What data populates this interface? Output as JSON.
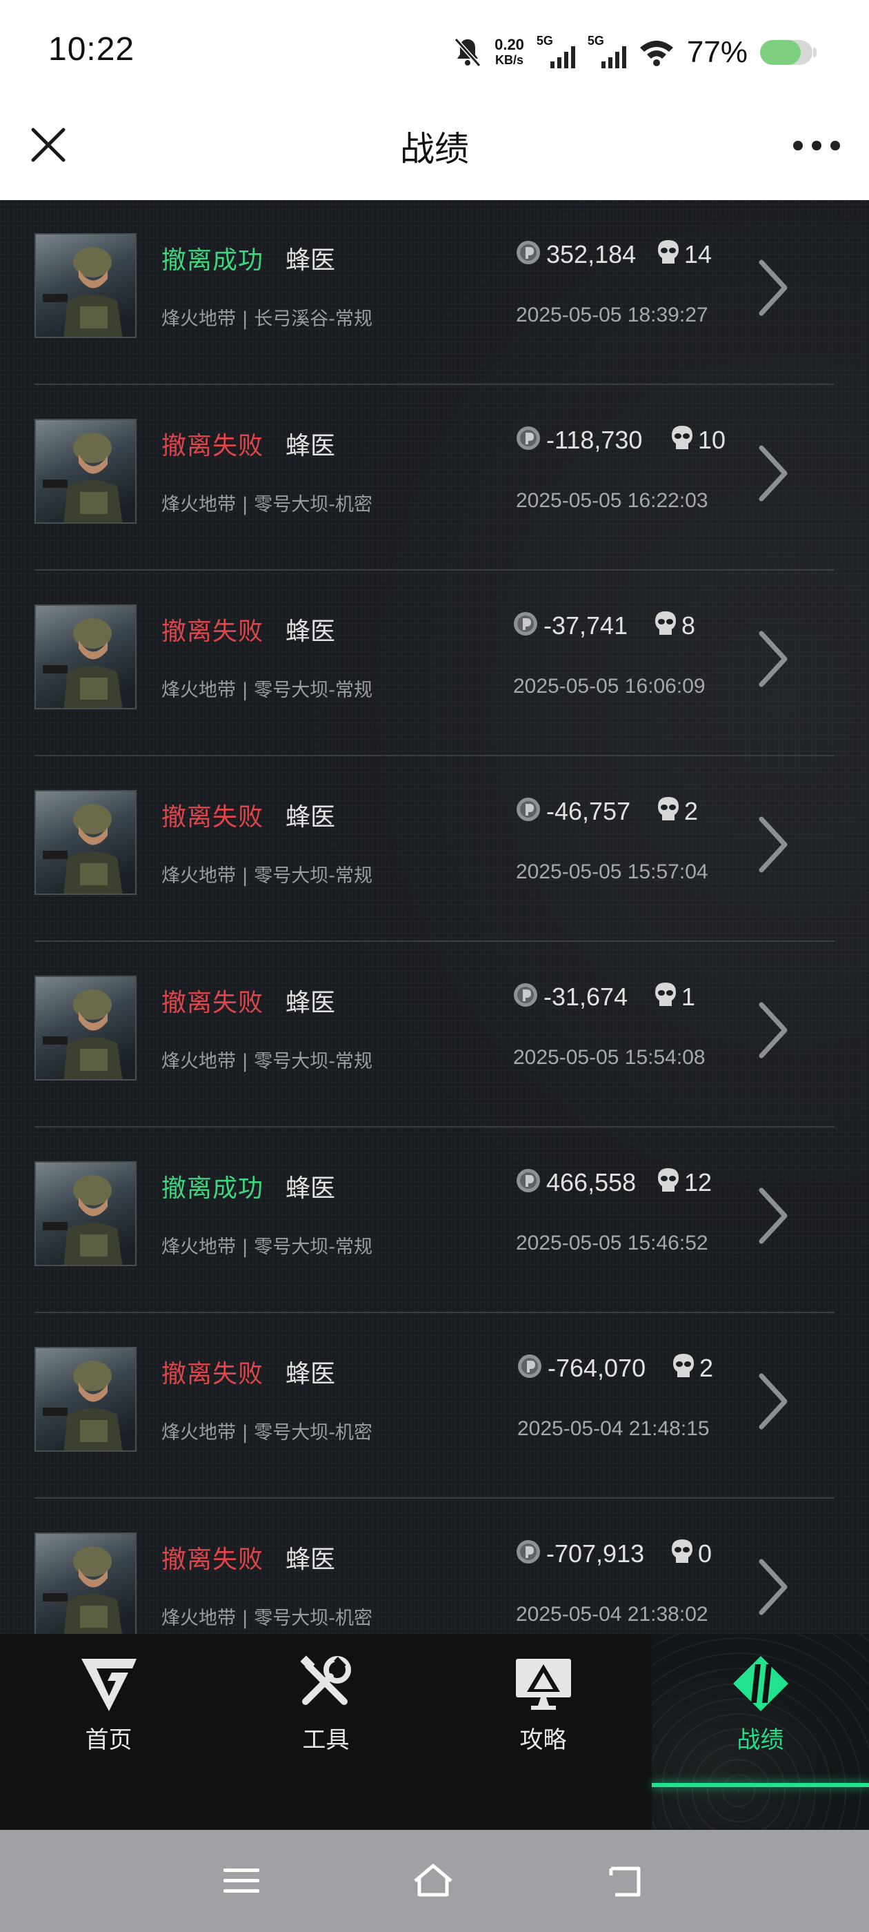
{
  "status_bar": {
    "time": "10:22",
    "net_speed_value": "0.20",
    "net_speed_unit": "KB/s",
    "sim1_tag": "5G",
    "sim2_tag": "5G",
    "battery_percent_text": "77%",
    "battery_level": 0.77,
    "battery_color": "#7ed07e",
    "icons": [
      "bell-muted-icon",
      "signal-icon",
      "signal-icon",
      "wifi-icon",
      "battery-icon"
    ]
  },
  "header": {
    "title": "战绩",
    "close_icon": "close-icon",
    "more_icon": "more-icon"
  },
  "records": [
    {
      "result": "撤离成功",
      "status": "success",
      "operator": "蜂医",
      "map": "烽火地带 | 长弓溪谷-常规",
      "value": "352,184",
      "kills": "14",
      "time": "2025-05-05 18:39:27"
    },
    {
      "result": "撤离失败",
      "status": "fail",
      "operator": "蜂医",
      "map": "烽火地带 | 零号大坝-机密",
      "value": "-118,730",
      "kills": "10",
      "time": "2025-05-05 16:22:03"
    },
    {
      "result": "撤离失败",
      "status": "fail",
      "operator": "蜂医",
      "map": "烽火地带 | 零号大坝-常规",
      "value": "-37,741",
      "kills": "8",
      "time": "2025-05-05 16:06:09"
    },
    {
      "result": "撤离失败",
      "status": "fail",
      "operator": "蜂医",
      "map": "烽火地带 | 零号大坝-常规",
      "value": "-46,757",
      "kills": "2",
      "time": "2025-05-05 15:57:04"
    },
    {
      "result": "撤离失败",
      "status": "fail",
      "operator": "蜂医",
      "map": "烽火地带 | 零号大坝-常规",
      "value": "-31,674",
      "kills": "1",
      "time": "2025-05-05 15:54:08"
    },
    {
      "result": "撤离成功",
      "status": "success",
      "operator": "蜂医",
      "map": "烽火地带 | 零号大坝-常规",
      "value": "466,558",
      "kills": "12",
      "time": "2025-05-05 15:46:52"
    },
    {
      "result": "撤离失败",
      "status": "fail",
      "operator": "蜂医",
      "map": "烽火地带 | 零号大坝-机密",
      "value": "-764,070",
      "kills": "2",
      "time": "2025-05-04 21:48:15"
    },
    {
      "result": "撤离失败",
      "status": "fail",
      "operator": "蜂医",
      "map": "烽火地带 | 零号大坝-机密",
      "value": "-707,913",
      "kills": "0",
      "time": "2025-05-04 21:38:02"
    }
  ],
  "record_icons": {
    "value": "coin-icon",
    "kills": "skull-icon",
    "open": "chevron-right-icon"
  },
  "colors": {
    "success": "#3ed67e",
    "fail": "#e0454a",
    "accent": "#22e38d"
  },
  "tabs": [
    {
      "label": "首页",
      "icon": "logo-g-icon",
      "active": false
    },
    {
      "label": "工具",
      "icon": "tools-icon",
      "active": false
    },
    {
      "label": "攻略",
      "icon": "guide-monitor-icon",
      "active": false
    },
    {
      "label": "战绩",
      "icon": "record-logo-icon",
      "active": true
    }
  ],
  "system_nav": [
    "menu-icon",
    "home-icon",
    "back-icon"
  ]
}
